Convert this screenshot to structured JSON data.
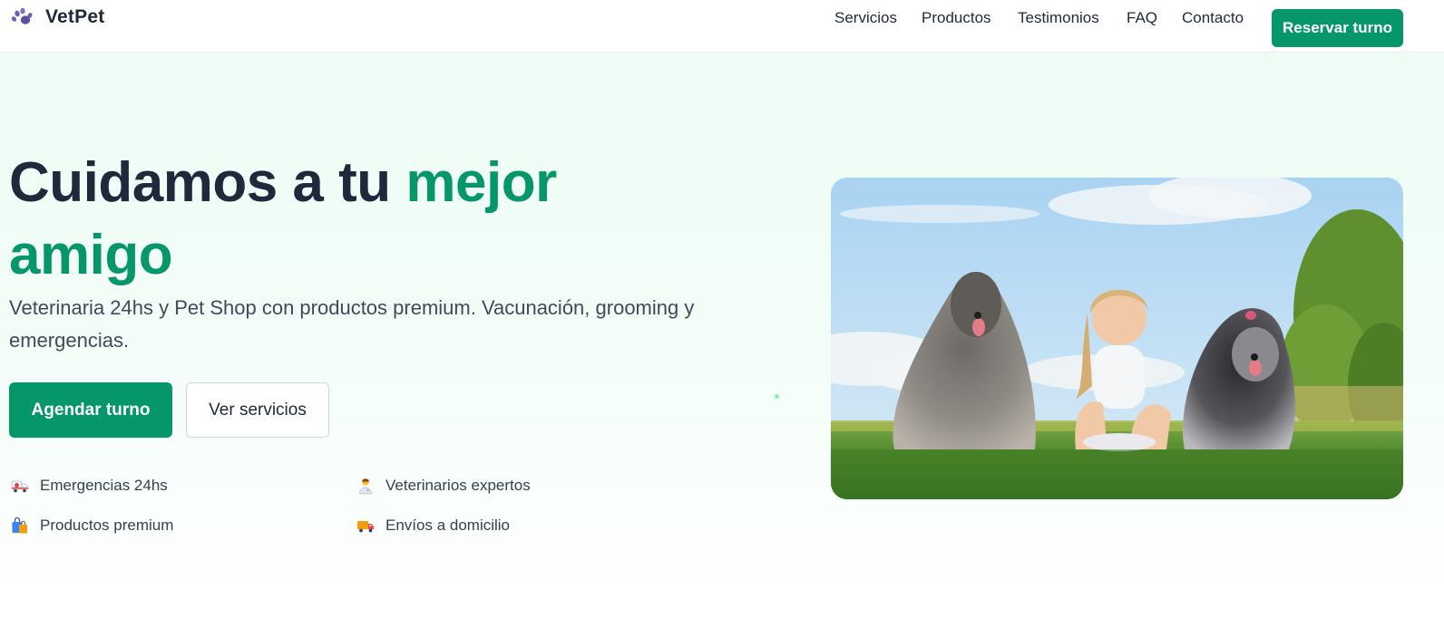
{
  "brand": {
    "icon": "paw-icon",
    "name": "VetPet"
  },
  "nav": {
    "links": [
      "Servicios",
      "Productos",
      "Testimonios",
      "FAQ",
      "Contacto"
    ],
    "cta": "Reservar turno"
  },
  "hero": {
    "title_part1": "Cuidamos a tu ",
    "title_accent": "mejor amigo",
    "subtitle": "Veterinaria 24hs y Pet Shop con productos premium. Vacunación, grooming y emergencias.",
    "primary_button": "Agendar turno",
    "secondary_button": "Ver servicios",
    "features": [
      {
        "icon": "ambulance-icon",
        "label": "Emergencias 24hs"
      },
      {
        "icon": "veterinarian-icon",
        "label": "Veterinarios expertos"
      },
      {
        "icon": "shopping-bags-icon",
        "label": "Productos premium"
      },
      {
        "icon": "delivery-truck-icon",
        "label": "Envíos a domicilio"
      }
    ],
    "image": {
      "icon": "hero-photo-girl-with-dogs"
    }
  },
  "colors": {
    "accent": "#059669",
    "text": "#1e293b",
    "background": "#ecfdf5"
  }
}
